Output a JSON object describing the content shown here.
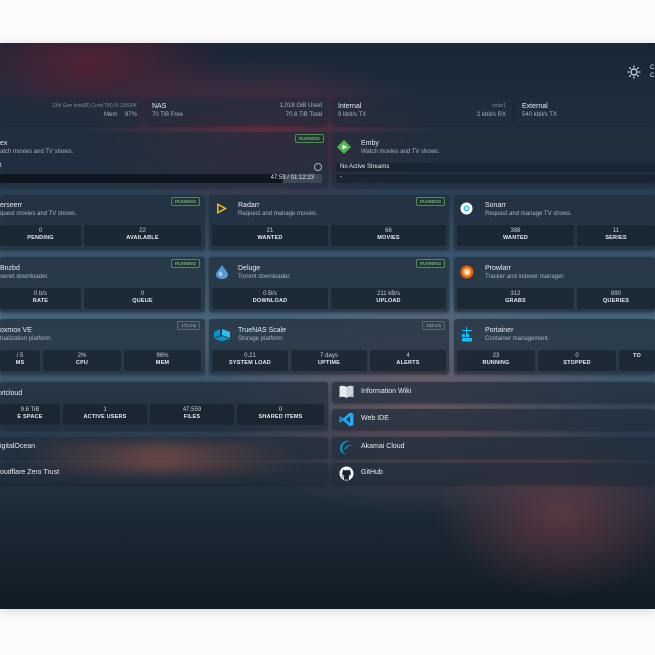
{
  "header": {
    "theme_icon": "sun-icon",
    "partial_labels": [
      "C",
      "C"
    ]
  },
  "resources": {
    "cpu_label_partial": "13th Gen Intel(R) Core(TM) i5-13500K",
    "mem_label": "Mem",
    "mem_value": "97%"
  },
  "nas": {
    "title": "NAS",
    "free": "70 TiB Free",
    "used_label": "1,018 GiB Used",
    "total": "70.6 TiB Total"
  },
  "internal": {
    "title": "Internal",
    "tx": "9 kbit/s TX",
    "iface": "vmbr1",
    "rx": "2 kbit/s RX"
  },
  "external": {
    "title": "External",
    "tx": "540 kbit/s TX"
  },
  "services": {
    "plex": {
      "name": "ex",
      "desc": "atch movies and TV shows.",
      "badge": "RUNNING",
      "stream_title": "t",
      "progress": 0.88,
      "time": "47:59 / 01:12:23"
    },
    "emby": {
      "name": "Emby",
      "desc": "Watch movies and TV shows.",
      "streams": "No Active Streams",
      "dash": "-"
    },
    "overseerr": {
      "name": "erseerr",
      "desc": "quest movies and TV shows.",
      "badge": "RUNNING",
      "stats": [
        {
          "v": "0",
          "l": "PENDING"
        },
        {
          "v": "22",
          "l": "AVAILABLE"
        }
      ]
    },
    "radarr": {
      "name": "Radarr",
      "desc": "Request and manage movies.",
      "badge": "RUNNING",
      "stats": [
        {
          "v": "21",
          "l": "WANTED"
        },
        {
          "v": "66",
          "l": "MOVIES"
        }
      ]
    },
    "sonarr": {
      "name": "Sonarr",
      "desc": "Request and manage TV shows.",
      "stats": [
        {
          "v": "388",
          "l": "WANTED"
        },
        {
          "v": "11",
          "l": "SERIES"
        }
      ]
    },
    "sabnzbd": {
      "name": "Bnzbd",
      "desc": "senet downloader.",
      "badge": "RUNNING",
      "stats": [
        {
          "v": "0 b/s",
          "l": "RATE"
        },
        {
          "v": "0",
          "l": "QUEUE"
        }
      ]
    },
    "deluge": {
      "name": "Deluge",
      "desc": "Torrent downloader.",
      "badge": "RUNNING",
      "stats": [
        {
          "v": "0 B/s",
          "l": "DOWNLOAD"
        },
        {
          "v": "211 kB/s",
          "l": "UPLOAD"
        }
      ]
    },
    "prowlarr": {
      "name": "Prowlarr",
      "desc": "Tracker and indexer manager.",
      "stats": [
        {
          "v": "312",
          "l": "GRABS"
        },
        {
          "v": "890",
          "l": "QUERIES"
        }
      ]
    },
    "proxmox": {
      "name": "oxmox VE",
      "desc": "tualization platform.",
      "badge": "173 ms",
      "stats": [
        {
          "v": "/ 5",
          "l": "MS"
        },
        {
          "v": "2%",
          "l": "CPU"
        },
        {
          "v": "96%",
          "l": "MEM"
        }
      ]
    },
    "truenas": {
      "name": "TrueNAS Scale",
      "desc": "Storage platform.",
      "badge": "233 ms",
      "stats": [
        {
          "v": "0.21",
          "l": "SYSTEM LOAD"
        },
        {
          "v": "7 days",
          "l": "UPTIME"
        },
        {
          "v": "4",
          "l": "ALERTS"
        }
      ]
    },
    "portainer": {
      "name": "Portainer",
      "desc": "Container management.",
      "stats": [
        {
          "v": "23",
          "l": "RUNNING"
        },
        {
          "v": "0",
          "l": "STOPPED"
        },
        {
          "v": "",
          "l": "TO"
        }
      ]
    },
    "nextcloud": {
      "name": "xtcloud",
      "stats": [
        {
          "v": "9.6 TiB",
          "l": "E SPACE"
        },
        {
          "v": "1",
          "l": "ACTIVE USERS"
        },
        {
          "v": "47,559",
          "l": "FILES"
        },
        {
          "v": "0",
          "l": "SHARED ITEMS"
        }
      ]
    },
    "digitalocean": {
      "name": "igitalOcean"
    },
    "cloudflare": {
      "name": "oudflare Zero Trust"
    }
  },
  "bookmarks": [
    {
      "label": "Information Wiki",
      "icon": "book-icon"
    },
    {
      "label": "Web IDE",
      "icon": "vscode-icon"
    },
    {
      "label": "Akamai Cloud",
      "icon": "akamai-icon"
    },
    {
      "label": "GitHub",
      "icon": "github-icon"
    }
  ]
}
